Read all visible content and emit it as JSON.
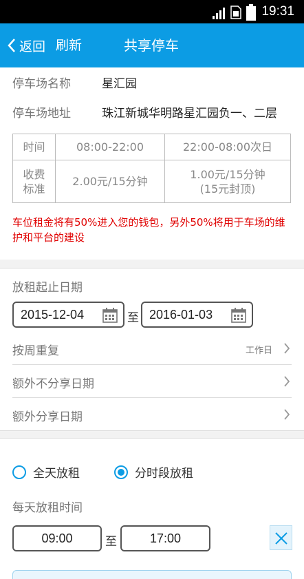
{
  "status_bar": {
    "time": "19:31"
  },
  "header": {
    "back_label": "返回",
    "refresh_label": "刷新",
    "title": "共享停车"
  },
  "parking": {
    "name_label": "停车场名称",
    "name_value": "星汇园",
    "address_label": "停车场地址",
    "address_value": "珠江新城华明路星汇园负一、二层"
  },
  "fee_table": {
    "time_label": "时间",
    "fee_label_line1": "收费",
    "fee_label_line2": "标准",
    "day_period": "08:00-22:00",
    "night_period": "22:00-08:00次日",
    "day_fee": "2.00元/15分钟",
    "night_fee_line1": "1.00元/15分钟",
    "night_fee_line2": "(15元封顶)"
  },
  "notice": "车位租金将有50%进入您的钱包，另外50%将用于车场的维护和平台的建设",
  "rental_dates": {
    "label": "放租起止日期",
    "start_date": "2015-12-04",
    "separator": "至",
    "end_date": "2016-01-03",
    "weekly_repeat_label": "按周重复",
    "weekly_repeat_value": "工作日",
    "exclude_dates_label": "额外不分享日期",
    "extra_dates_label": "额外分享日期"
  },
  "rent_mode": {
    "option_full_day": "全天放租",
    "option_time_slot": "分时段放租",
    "selected": "分时段放租",
    "daily_time_label": "每天放租时间",
    "start_time": "09:00",
    "separator": "至",
    "end_time": "17:00"
  },
  "colors": {
    "accent": "#0c9ce4",
    "notice": "#e00000",
    "status_bar": "#000000"
  }
}
